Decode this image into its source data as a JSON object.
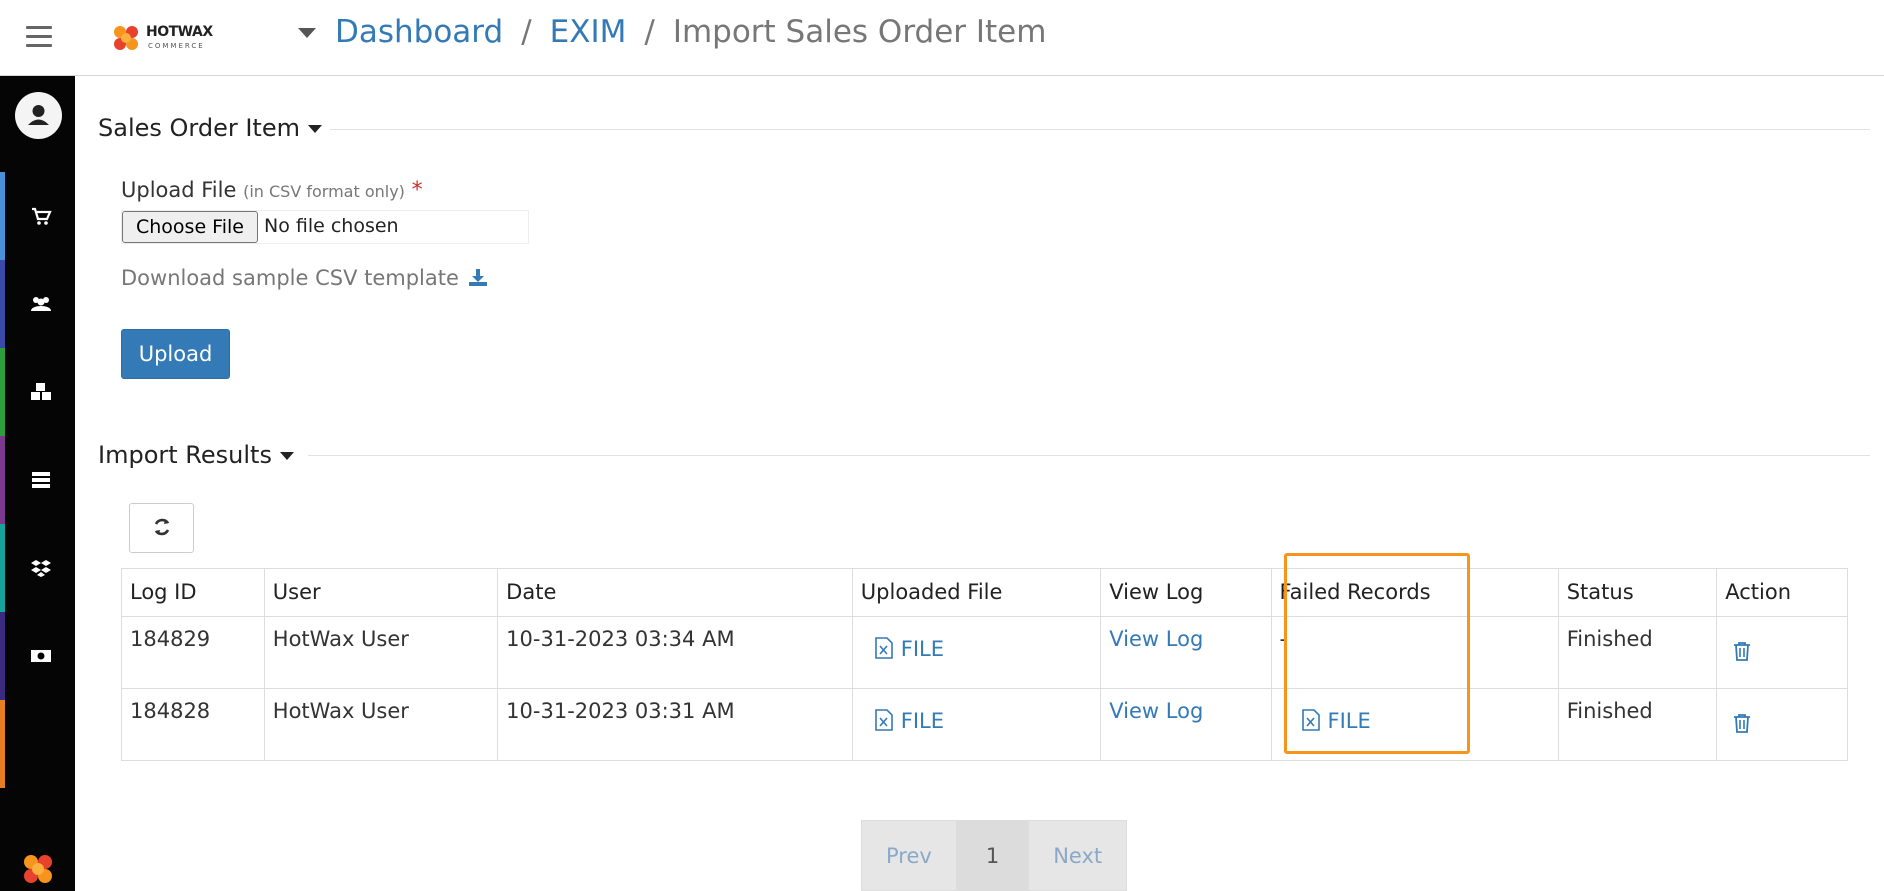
{
  "header": {
    "logo_text": "HOTWAX",
    "logo_sub": "COMMERCE",
    "breadcrumb": [
      {
        "label": "Dashboard"
      },
      {
        "label": "EXIM"
      }
    ],
    "current_page": "Import Sales Order Item",
    "separator": "/"
  },
  "sidebar": {
    "items": [
      {
        "icon": "cart-icon",
        "color": "#4a90d9"
      },
      {
        "icon": "users-icon",
        "color": "#3b4aa8"
      },
      {
        "icon": "boxes-icon",
        "color": "#2e9e3c"
      },
      {
        "icon": "server-icon",
        "color": "#7a3b8f"
      },
      {
        "icon": "dropbox-icon",
        "color": "#18a39a"
      },
      {
        "icon": "money-icon",
        "color": "#3a2a80"
      },
      {
        "icon": "more-icon",
        "color": "#e67e22"
      }
    ]
  },
  "upload_section": {
    "title": "Sales Order Item",
    "file_label": "Upload File",
    "file_hint": "(in CSV format only)",
    "required_mark": "*",
    "choose_button": "Choose File",
    "no_file_text": "No file chosen",
    "download_link": "Download sample CSV template",
    "upload_button": "Upload"
  },
  "results_section": {
    "title": "Import Results",
    "columns": [
      "Log ID",
      "User",
      "Date",
      "Uploaded File",
      "View Log",
      "Failed Records",
      "Status",
      "Action"
    ],
    "rows": [
      {
        "log_id": "184829",
        "user": "HotWax User",
        "date": "10-31-2023 03:34 AM",
        "uploaded_file": "FILE",
        "view_log": "View Log",
        "failed_records": "-",
        "status": "Finished"
      },
      {
        "log_id": "184828",
        "user": "HotWax User",
        "date": "10-31-2023 03:31 AM",
        "uploaded_file": "FILE",
        "view_log": "View Log",
        "failed_records": "FILE",
        "status": "Finished"
      }
    ]
  },
  "pagination": {
    "prev": "Prev",
    "current": "1",
    "next": "Next"
  },
  "colors": {
    "accent": "#337ab7",
    "highlight": "#f7941d"
  }
}
